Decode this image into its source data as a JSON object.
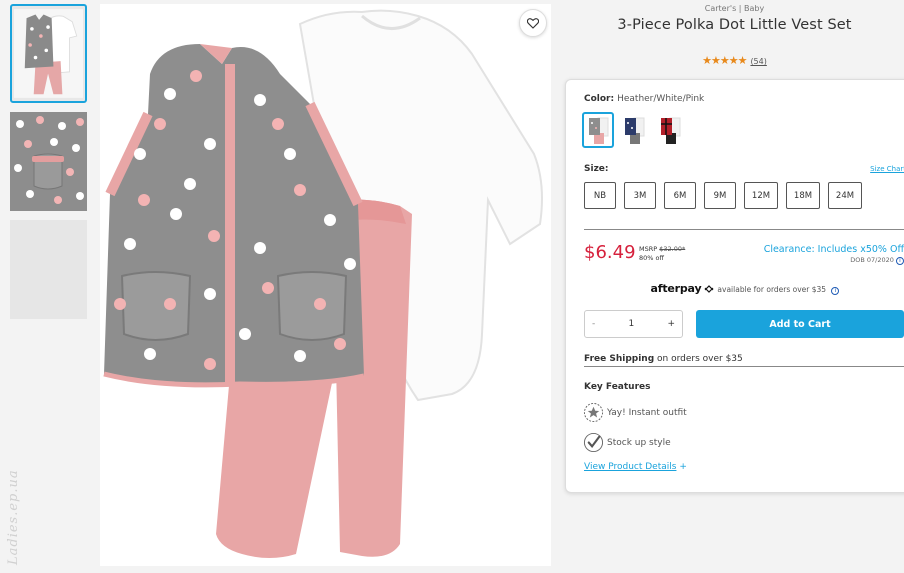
{
  "brand_line": "Carter's | Baby",
  "product": {
    "title": "3-Piece Polka Dot Little Vest Set",
    "stars": "★★★★★",
    "review_count": "(54)"
  },
  "color": {
    "label": "Color:",
    "value": "Heather/White/Pink"
  },
  "size": {
    "label": "Size:",
    "chart_link": "Size Chart",
    "options": [
      "NB",
      "3M",
      "6M",
      "9M",
      "12M",
      "18M",
      "24M"
    ]
  },
  "pricing": {
    "price": "$6.49",
    "msrp_label": "MSRP",
    "msrp_value": "$32.00*",
    "discount": "80% off",
    "clearance": "Clearance: Includes x50% Off",
    "dob": "DOB 07/2020"
  },
  "afterpay": {
    "logo": "afterpay",
    "text": "available for orders over $35"
  },
  "quantity": {
    "minus": "-",
    "value": "1",
    "plus": "+"
  },
  "add_to_cart": "Add to Cart",
  "shipping": {
    "bold": "Free Shipping",
    "rest": "on orders over $35"
  },
  "features": {
    "title": "Key Features",
    "items": [
      "Yay! Instant outfit",
      "Stock up style"
    ],
    "details_link": "View Product Details",
    "details_plus": "+"
  },
  "watermark": "Ladies.ep.ua",
  "colors": {
    "accent": "#1aa3dc",
    "price_red": "#d6213c",
    "star_orange": "#e8891b",
    "vest_gray": "#8c8c8c",
    "pink": "#e8a3a3"
  }
}
